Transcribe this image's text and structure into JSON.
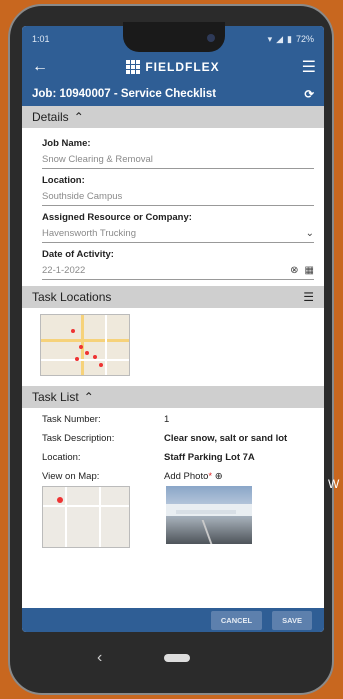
{
  "status": {
    "time": "1:01",
    "battery": "72%"
  },
  "app": {
    "brand": "FIELDFLEX",
    "title": "Job: 10940007 - Service Checklist"
  },
  "details": {
    "header": "Details",
    "fields": [
      {
        "label": "Job Name:",
        "value": "Snow Clearing & Removal"
      },
      {
        "label": "Location:",
        "value": "Southside Campus"
      },
      {
        "label": "Assigned Resource or Company:",
        "value": "Havensworth Trucking"
      },
      {
        "label": "Date of Activity:",
        "value": "22-1-2022"
      }
    ]
  },
  "task_locations": {
    "header": "Task Locations"
  },
  "task_list": {
    "header": "Task List",
    "rows": [
      {
        "key": "Task Number:",
        "value": "1"
      },
      {
        "key": "Task Description:",
        "value": "Clear snow, salt or sand lot"
      },
      {
        "key": "Location:",
        "value": "Staff Parking Lot 7A"
      }
    ],
    "view_on_map": "View on Map:",
    "add_photo": "Add Photo"
  },
  "footer": {
    "cancel": "CANCEL",
    "save": "SAVE"
  },
  "cut_text": "W"
}
